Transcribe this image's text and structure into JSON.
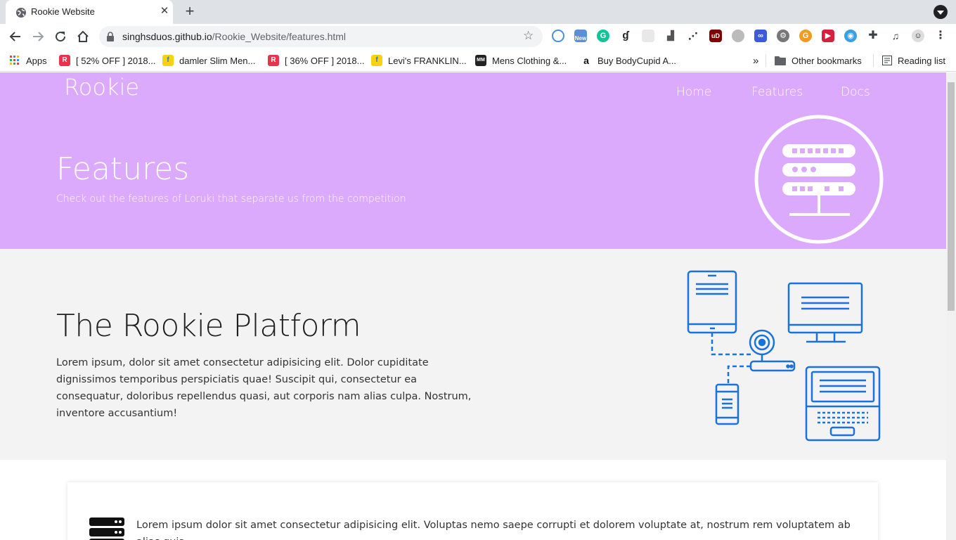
{
  "browser": {
    "tab_title": "Rookie Website",
    "url_host": "singhsduos.github.io",
    "url_path": "/Rookie_Website/features.html",
    "bookmarks": [
      {
        "label": "Apps",
        "icon": "apps-grid-icon",
        "color": "#4285f4"
      },
      {
        "label": "[ 52% OFF ] 2018...",
        "icon": "r-logo-icon",
        "color": "#e8334a"
      },
      {
        "label": "damler Slim Men...",
        "icon": "flipkart-icon",
        "color": "#f8d210"
      },
      {
        "label": "[ 36% OFF ] 2018...",
        "icon": "r-logo-icon",
        "color": "#e8334a"
      },
      {
        "label": "Levi's FRANKLIN...",
        "icon": "flipkart-icon",
        "color": "#f8d210"
      },
      {
        "label": "Mens Clothing &...",
        "icon": "myntra-icon",
        "color": "#222222"
      },
      {
        "label": "Buy BodyCupid A...",
        "icon": "amazon-icon",
        "color": "#ffffff"
      }
    ],
    "overflow_label": "»",
    "other_bookmarks": "Other bookmarks",
    "reading_list": "Reading list"
  },
  "site": {
    "brand": "Rookie",
    "nav": [
      "Home",
      "Features",
      "Docs"
    ],
    "hero_title": "Features",
    "hero_subtitle": "Check out the features of Loruki that separate us from the competition",
    "platform_title": "The Rookie Platform",
    "platform_text": "Lorem ipsum, dolor sit amet consectetur adipisicing elit. Dolor cupiditate dignissimos temporibus perspiciatis quae! Suscipit qui, consectetur ea consequatur, doloribus repellendus quasi, aut corporis nam alias culpa. Nostrum, inventore accusantium!",
    "card_text": "Lorem ipsum dolor sit amet consectetur adipisicing elit. Voluptas nemo saepe corrupti et dolorem voluptate at, nostrum rem voluptatem ab alias quia"
  },
  "colors": {
    "hero_bg": "#dcaafc",
    "platform_bg": "#f3f3f3",
    "device_stroke": "#1a73d9"
  }
}
